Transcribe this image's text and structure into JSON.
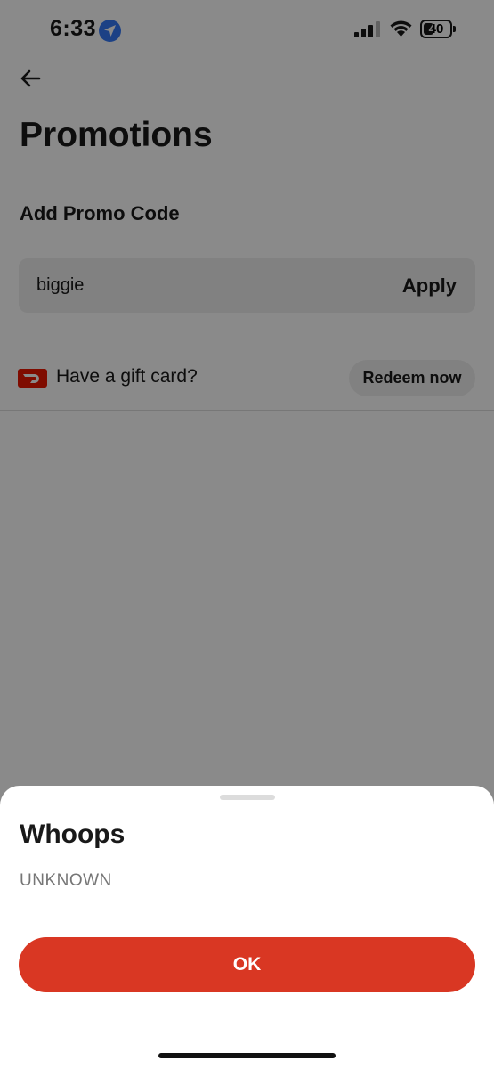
{
  "status_bar": {
    "time": "6:33",
    "battery": "40",
    "battery_level": 0.4,
    "icons": [
      "location-arrow-icon",
      "signal-icon",
      "wifi-icon",
      "battery-icon"
    ]
  },
  "page": {
    "title": "Promotions",
    "promo_section": {
      "title": "Add Promo Code",
      "input_value": "biggie",
      "apply_label": "Apply"
    },
    "gift_card": {
      "text": "Have a gift card?",
      "redeem_label": "Redeem now"
    }
  },
  "sheet": {
    "title": "Whoops",
    "message": "UNKNOWN",
    "ok_label": "OK"
  },
  "colors": {
    "brand_red": "#d93723",
    "gift_icon_red": "#eb1700",
    "location_blue": "#3478f6",
    "field_background": "#eeeeee"
  }
}
